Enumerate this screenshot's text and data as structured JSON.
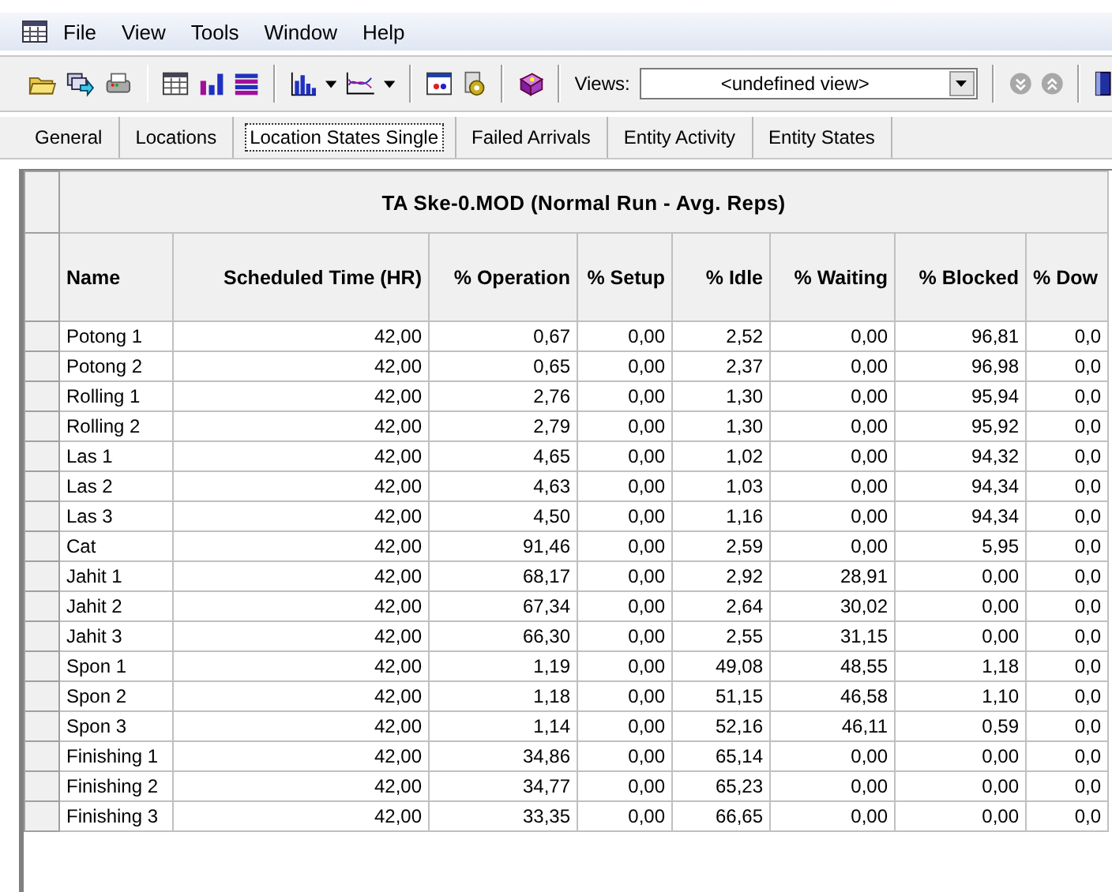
{
  "menu": [
    "File",
    "View",
    "Tools",
    "Window",
    "Help"
  ],
  "toolbar": {
    "views_label": "Views:",
    "views_value": "<undefined view>"
  },
  "tabs": [
    {
      "label": "General",
      "selected": false
    },
    {
      "label": "Locations",
      "selected": false
    },
    {
      "label": "Location States Single",
      "selected": true
    },
    {
      "label": "Failed Arrivals",
      "selected": false
    },
    {
      "label": "Entity Activity",
      "selected": false
    },
    {
      "label": "Entity States",
      "selected": false
    }
  ],
  "table": {
    "title": "TA Ske-0.MOD (Normal Run - Avg. Reps)",
    "columns": [
      "Name",
      "Scheduled Time (HR)",
      "% Operation",
      "% Setup",
      "% Idle",
      "% Waiting",
      "% Blocked",
      "% Dow"
    ],
    "rows": [
      [
        "Potong 1",
        "42,00",
        "0,67",
        "0,00",
        "2,52",
        "0,00",
        "96,81",
        "0,0"
      ],
      [
        "Potong 2",
        "42,00",
        "0,65",
        "0,00",
        "2,37",
        "0,00",
        "96,98",
        "0,0"
      ],
      [
        "Rolling 1",
        "42,00",
        "2,76",
        "0,00",
        "1,30",
        "0,00",
        "95,94",
        "0,0"
      ],
      [
        "Rolling 2",
        "42,00",
        "2,79",
        "0,00",
        "1,30",
        "0,00",
        "95,92",
        "0,0"
      ],
      [
        "Las 1",
        "42,00",
        "4,65",
        "0,00",
        "1,02",
        "0,00",
        "94,32",
        "0,0"
      ],
      [
        "Las 2",
        "42,00",
        "4,63",
        "0,00",
        "1,03",
        "0,00",
        "94,34",
        "0,0"
      ],
      [
        "Las 3",
        "42,00",
        "4,50",
        "0,00",
        "1,16",
        "0,00",
        "94,34",
        "0,0"
      ],
      [
        "Cat",
        "42,00",
        "91,46",
        "0,00",
        "2,59",
        "0,00",
        "5,95",
        "0,0"
      ],
      [
        "Jahit 1",
        "42,00",
        "68,17",
        "0,00",
        "2,92",
        "28,91",
        "0,00",
        "0,0"
      ],
      [
        "Jahit 2",
        "42,00",
        "67,34",
        "0,00",
        "2,64",
        "30,02",
        "0,00",
        "0,0"
      ],
      [
        "Jahit 3",
        "42,00",
        "66,30",
        "0,00",
        "2,55",
        "31,15",
        "0,00",
        "0,0"
      ],
      [
        "Spon 1",
        "42,00",
        "1,19",
        "0,00",
        "49,08",
        "48,55",
        "1,18",
        "0,0"
      ],
      [
        "Spon 2",
        "42,00",
        "1,18",
        "0,00",
        "51,15",
        "46,58",
        "1,10",
        "0,0"
      ],
      [
        "Spon 3",
        "42,00",
        "1,14",
        "0,00",
        "52,16",
        "46,11",
        "0,59",
        "0,0"
      ],
      [
        "Finishing 1",
        "42,00",
        "34,86",
        "0,00",
        "65,14",
        "0,00",
        "0,00",
        "0,0"
      ],
      [
        "Finishing 2",
        "42,00",
        "34,77",
        "0,00",
        "65,23",
        "0,00",
        "0,00",
        "0,0"
      ],
      [
        "Finishing 3",
        "42,00",
        "33,35",
        "0,00",
        "66,65",
        "0,00",
        "0,00",
        "0,0"
      ]
    ]
  }
}
